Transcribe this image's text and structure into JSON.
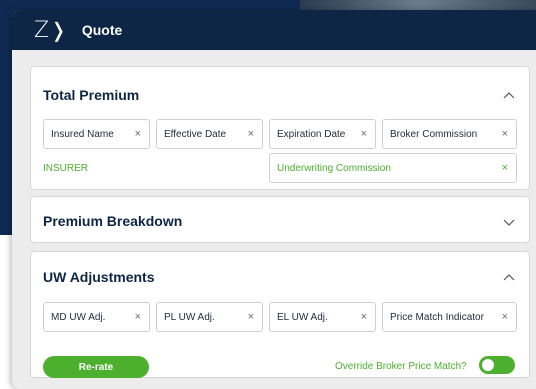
{
  "header": {
    "logo_letter": "Z",
    "logo_chevron": "❭",
    "title": "Quote"
  },
  "total_premium": {
    "title": "Total Premium",
    "toggle_icon": "chevron-up",
    "chips": [
      {
        "label": "Insured Name",
        "remove": "×"
      },
      {
        "label": "Effective Date",
        "remove": "×"
      },
      {
        "label": "Expiration Date",
        "remove": "×"
      },
      {
        "label": "Broker Commission",
        "remove": "×"
      }
    ],
    "insurer_label": "INSURER",
    "uw_commission": {
      "label": "Underwriting Commission",
      "remove": "×"
    }
  },
  "premium_breakdown": {
    "title": "Premium Breakdown",
    "toggle_icon": "chevron-down"
  },
  "uw_adjustments": {
    "title": "UW Adjustments",
    "toggle_icon": "chevron-up",
    "chips": [
      {
        "label": "MD UW Adj.",
        "remove": "×"
      },
      {
        "label": "PL UW Adj.",
        "remove": "×"
      },
      {
        "label": "EL UW Adj.",
        "remove": "×"
      },
      {
        "label": "Price Match Indicator",
        "remove": "×"
      }
    ],
    "rerate_label": "Re-rate",
    "override_label": "Override Broker Price Match?",
    "override_on": true
  },
  "colors": {
    "navy": "#0e2645",
    "green": "#4caf2e",
    "panel": "#ececec"
  }
}
